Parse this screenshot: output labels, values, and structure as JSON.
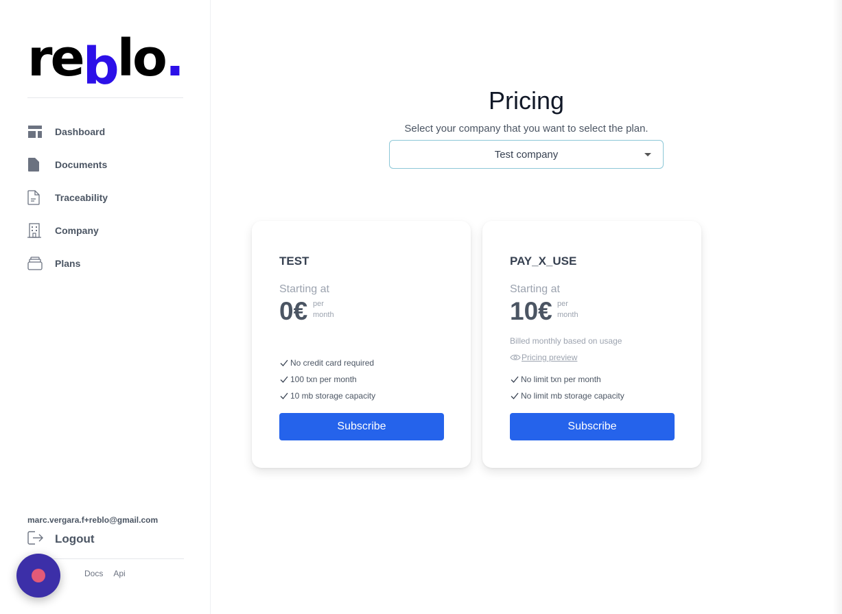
{
  "brand": {
    "logo_text_1": "re",
    "logo_text_b": "b",
    "logo_text_2": "lo",
    "logo_dot": ".",
    "accent_color": "#2c10e8"
  },
  "sidebar": {
    "items": [
      {
        "label": "Dashboard",
        "icon": "dashboard-icon"
      },
      {
        "label": "Documents",
        "icon": "document-icon"
      },
      {
        "label": "Traceability",
        "icon": "file-lines-icon"
      },
      {
        "label": "Company",
        "icon": "building-icon"
      },
      {
        "label": "Plans",
        "icon": "stack-icon"
      }
    ],
    "user_email": "marc.vergara.f+reblo@gmail.com",
    "logout_label": "Logout",
    "footer_links": [
      "Docs",
      "Api"
    ]
  },
  "main": {
    "title": "Pricing",
    "subtitle": "Select your company that you want to select the plan.",
    "company_select": {
      "selected": "Test company"
    }
  },
  "plans": [
    {
      "name": "TEST",
      "starting_label": "Starting at",
      "price": "0€",
      "per": "per",
      "period": "month",
      "features": [
        "No credit card required",
        "100 txn per month",
        "10 mb storage capacity"
      ],
      "button": "Subscribe"
    },
    {
      "name": "PAY_X_USE",
      "starting_label": "Starting at",
      "price": "10€",
      "per": "per",
      "period": "month",
      "note": "Billed monthly based on usage",
      "preview_link": "Pricing preview",
      "features": [
        "No limit txn per month",
        "No limit mb storage capacity"
      ],
      "button": "Subscribe"
    }
  ],
  "colors": {
    "primary_button": "#2563eb",
    "select_border": "#8cc7d7",
    "chat_bubble": "#3c2fa8"
  }
}
